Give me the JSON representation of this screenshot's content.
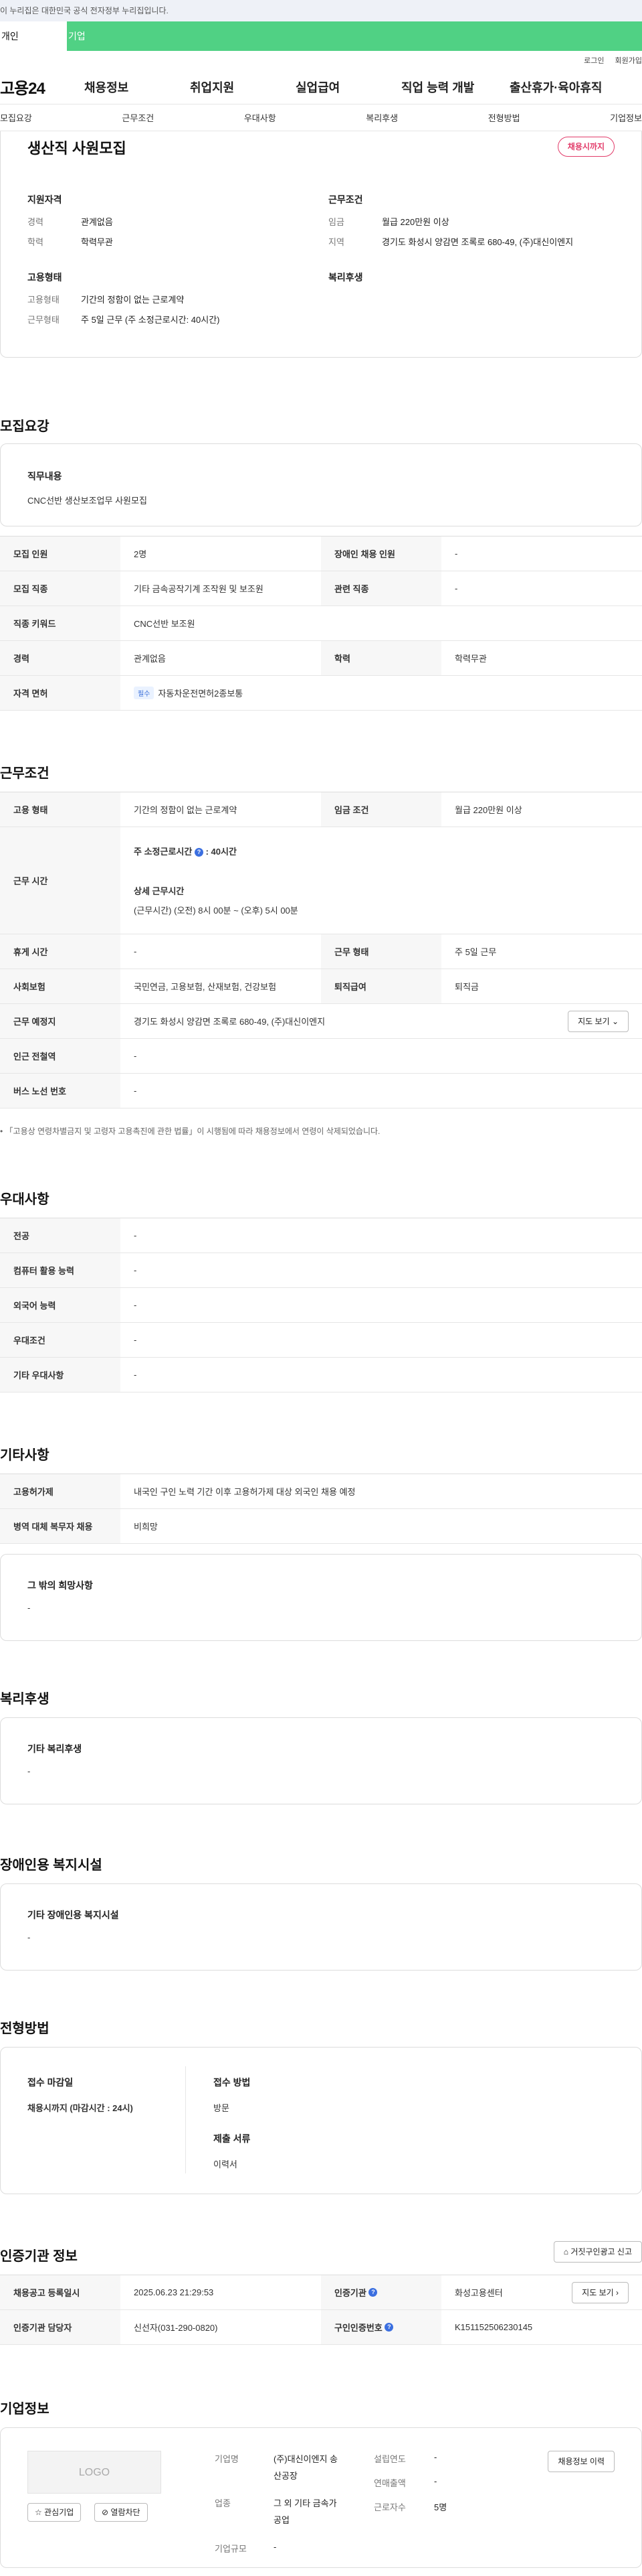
{
  "gov_banner": "이 누리집은 대한민국 공식 전자정부 누리집입니다.",
  "user_tabs": [
    "개인",
    "기업"
  ],
  "util": [
    "로그인",
    "회원가입"
  ],
  "logo": "고용24",
  "gnb": [
    "채용정보",
    "취업지원",
    "실업급여",
    "직업 능력 개발",
    "출산휴가·육아휴직"
  ],
  "subnav": [
    "모집요강",
    "근무조건",
    "우대사항",
    "복리후생",
    "전형방법",
    "기업정보"
  ],
  "summary": {
    "title": "생산직 사원모집",
    "status": "채용시까지",
    "qual_h": "지원자격",
    "career_k": "경력",
    "career_v": "관계없음",
    "edu_k": "학력",
    "edu_v": "학력무관",
    "work_h": "근무조건",
    "wage_k": "임금",
    "wage_v": "월급 220만원 이상",
    "region_k": "지역",
    "region_v": "경기도 화성시 양감면 조록로 680-49, (주)대신이엔지",
    "emp_h": "고용형태",
    "emptype_k": "고용형태",
    "emptype_v": "기간의 정함이 없는 근로계약",
    "worktype_k": "근무형태",
    "worktype_v": "주 5일 근무 (주 소정근로시간: 40시간)",
    "welfare_h": "복리후생"
  },
  "recruit": {
    "title": "모집요강",
    "duty_h": "직무내용",
    "duty_v": "CNC선반 생산보조업무 사원모집",
    "rows": {
      "count_k": "모집 인원",
      "count_v": "2명",
      "disabled_k": "장애인 채용 인원",
      "disabled_v": "-",
      "job_k": "모집 직종",
      "job_v": "기타 금속공작기계 조작원 및 보조원",
      "related_k": "관련 직종",
      "related_v": "-",
      "keyword_k": "직종 키워드",
      "keyword_v": "CNC선반 보조원",
      "career_k": "경력",
      "career_v": "관계없음",
      "edu_k": "학력",
      "edu_v": "학력무관",
      "license_k": "자격 면허",
      "license_badge": "필수",
      "license_v": "자동차운전면허2종보통"
    }
  },
  "conditions": {
    "title": "근무조건",
    "emptype_k": "고용 형태",
    "emptype_v": "기간의 정함이 없는 근로계약",
    "wage_k": "임금 조건",
    "wage_v": "월급 220만원 이상",
    "hours_k": "근무 시간",
    "hours_main": "주 소정근로시간",
    "hours_main_v": ": 40시간",
    "hours_detail_h": "상세 근무시간",
    "hours_detail_v": "(근무시간) (오전) 8시 00분 ~ (오후) 5시 00분",
    "break_k": "휴게 시간",
    "break_v": "-",
    "form_k": "근무 형태",
    "form_v": "주 5일 근무",
    "ins_k": "사회보험",
    "ins_v": "국민연금, 고용보험, 산재보험, 건강보험",
    "sev_k": "퇴직급여",
    "sev_v": "퇴직금",
    "place_k": "근무 예정지",
    "place_v": "경기도 화성시 양감면 조록로 680-49, (주)대신이엔지",
    "map_btn": "지도 보기",
    "station_k": "인근 전철역",
    "station_v": "-",
    "bus_k": "버스 노선 번호",
    "bus_v": "-",
    "note": "「고용상 연령차별금지 및 고령자 고용촉진에 관한 법률」이 시행됨에 따라 채용정보에서 연령이 삭제되었습니다."
  },
  "preference": {
    "title": "우대사항",
    "major_k": "전공",
    "major_v": "-",
    "pc_k": "컴퓨터 활용 능력",
    "pc_v": "-",
    "lang_k": "외국어 능력",
    "lang_v": "-",
    "cond_k": "우대조건",
    "cond_v": "-",
    "etc_k": "기타 우대사항",
    "etc_v": "-"
  },
  "others": {
    "title": "기타사항",
    "permit_k": "고용허가제",
    "permit_v": "내국인 구인 노력 기간 이후 고용허가제 대상 외국인 채용 예정",
    "military_k": "병역 대체 복무자 채용",
    "military_v": "비희망",
    "etc_h": "그 밖의 희망사항",
    "etc_v": "-"
  },
  "welfare": {
    "title": "복리후생",
    "h": "기타 복리후생",
    "v": "-"
  },
  "facility": {
    "title": "장애인용 복지시설",
    "h": "기타 장애인용 복지시설",
    "v": "-"
  },
  "selection": {
    "title": "전형방법",
    "deadline_h": "접수 마감일",
    "deadline_v": "채용시까지 (마감시간 : 24시)",
    "method_h": "접수 방법",
    "method_v": "방문",
    "docs_h": "제출 서류",
    "docs_v": "이력서"
  },
  "agency": {
    "title": "인증기관 정보",
    "report_btn": "거짓구인광고 신고",
    "reg_k": "채용공고 등록일시",
    "reg_v": "2025.06.23 21:29:53",
    "org_k": "인증기관",
    "org_v": "화성고용센터",
    "map_btn": "지도 보기",
    "manager_k": "인증기관 담당자",
    "manager_v": "신선자(031-290-0820)",
    "no_k": "구인인증번호",
    "no_v": "K151152506230145"
  },
  "company": {
    "title": "기업정보",
    "logo": "LOGO",
    "fav_btn": "관심기업",
    "block_btn": "열람차단",
    "name_k": "기업명",
    "name_v1": "(주)대신이엔지 송",
    "name_v2": "산공장",
    "industry_k": "업종",
    "industry_v1": "그 외 기타 금속가",
    "industry_v2": "공업",
    "size_k": "기업규모",
    "size_v": "-",
    "founded_k": "설립연도",
    "founded_v": "-",
    "sales_k": "연매출액",
    "sales_v": "-",
    "staff_k": "근로자수",
    "staff_v": "5명",
    "history_btn": "채용정보 이력"
  }
}
